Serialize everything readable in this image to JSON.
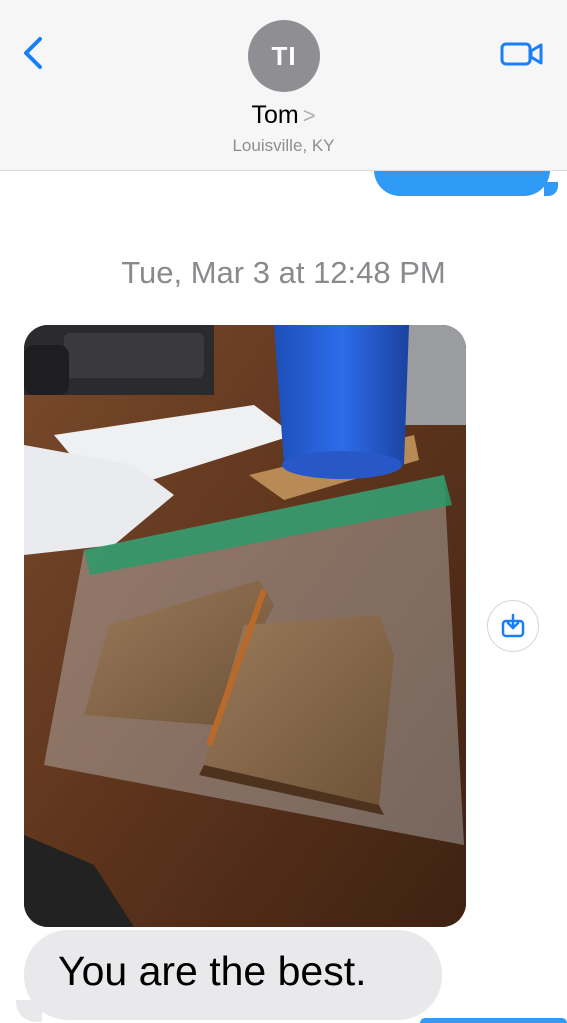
{
  "header": {
    "avatar_initials": "TI",
    "contact_name": "Tom",
    "name_chevron": ">",
    "location": "Louisville, KY",
    "icons": {
      "back": "chevron-left-icon",
      "video": "video-camera-icon"
    },
    "accent_color": "#1a7ff6"
  },
  "thread": {
    "timestamp_day": "Tue, Mar 3",
    "timestamp_at": "at",
    "timestamp_time": "12:48 PM",
    "photo_icon": "photo-attachment",
    "save_icon": "download-icon",
    "received_message": "You are the best.",
    "sent_bubble_color": "#2f9bf7",
    "received_bubble_color": "#e9e9eb"
  }
}
